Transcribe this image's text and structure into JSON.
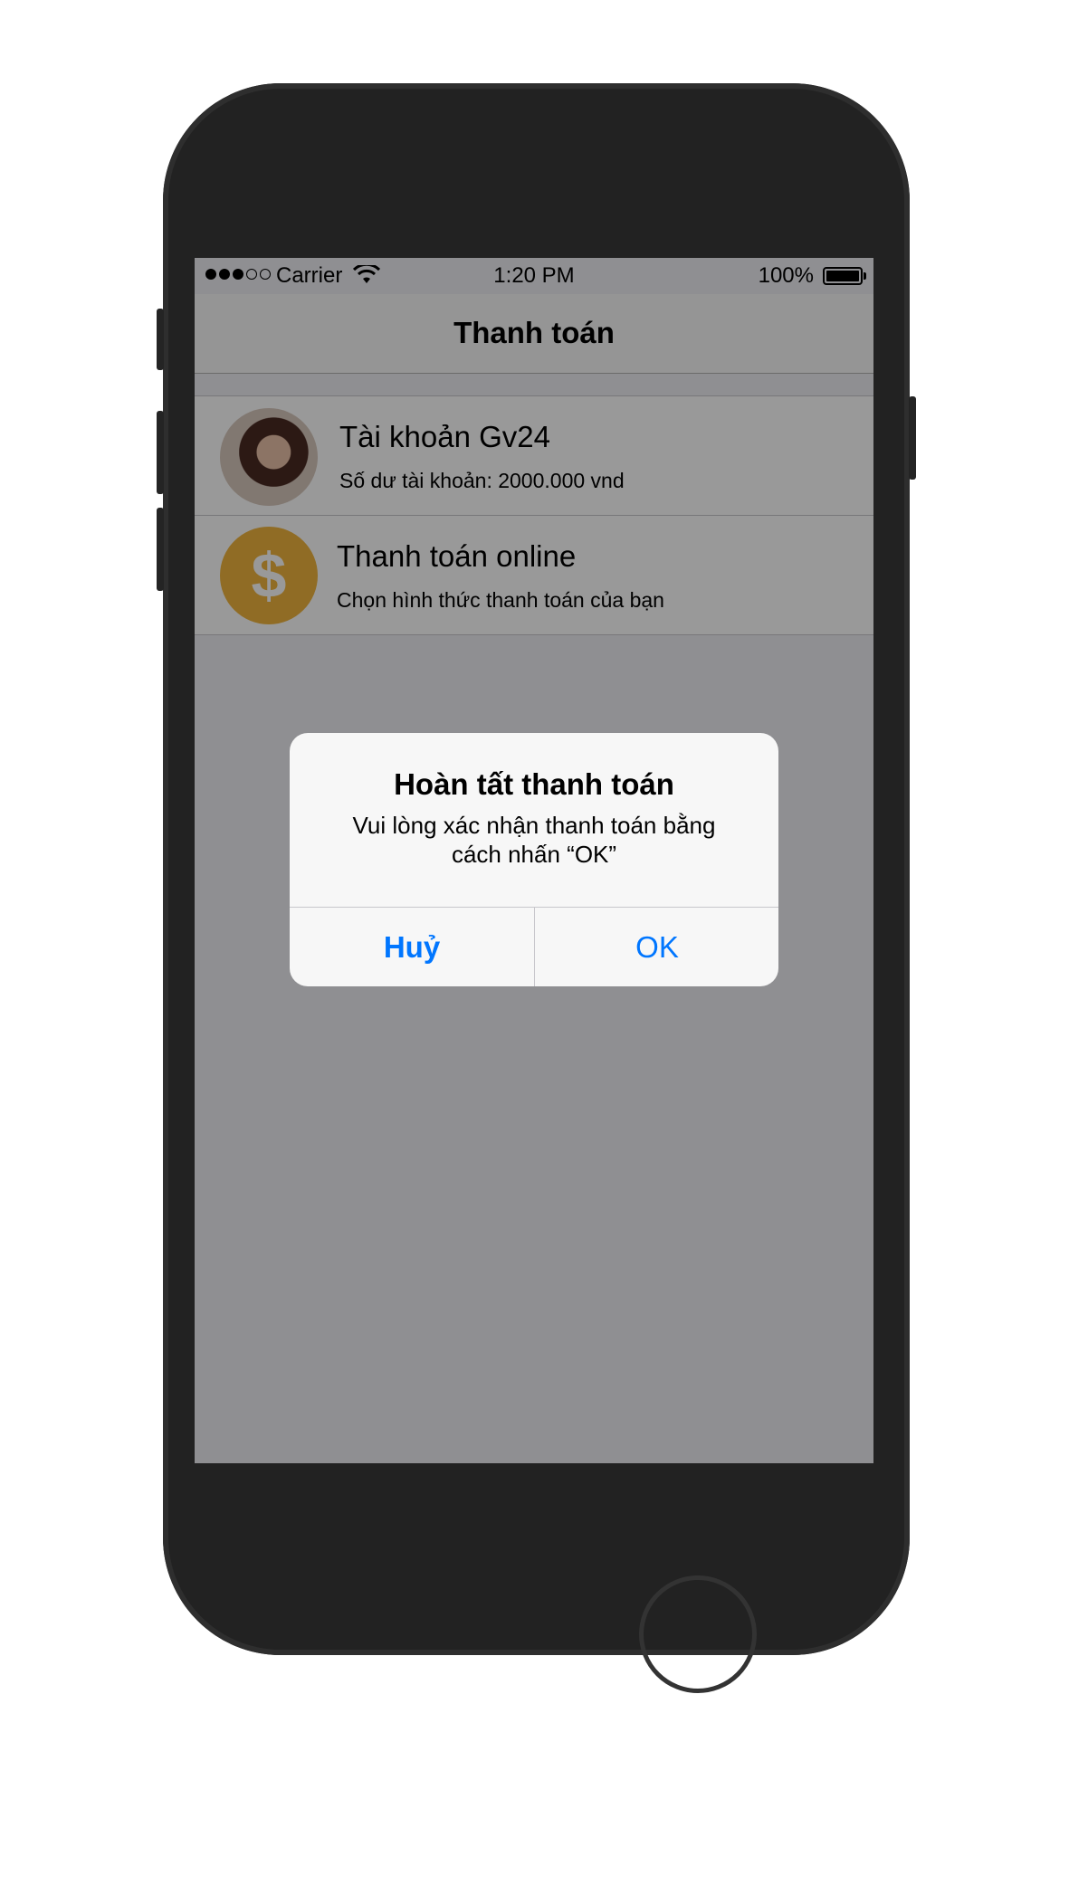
{
  "status_bar": {
    "carrier": "Carrier",
    "time": "1:20 PM",
    "battery": "100%"
  },
  "nav": {
    "title": "Thanh toán"
  },
  "list": {
    "items": [
      {
        "title": "Tài khoản Gv24",
        "subtitle": "Số dư tài khoản: 2000.000 vnd",
        "icon": "avatar-photo"
      },
      {
        "title": "Thanh toán online",
        "subtitle": "Chọn hình thức thanh toán của bạn",
        "icon": "dollar-icon",
        "icon_symbol": "$",
        "icon_color": "#f0b53e"
      }
    ]
  },
  "alert": {
    "title": "Hoàn tất thanh toán",
    "message": "Vui lòng xác nhận thanh toán bằng cách nhấn “OK”",
    "cancel_label": "Huỷ",
    "ok_label": "OK",
    "button_color": "#0076ff"
  }
}
